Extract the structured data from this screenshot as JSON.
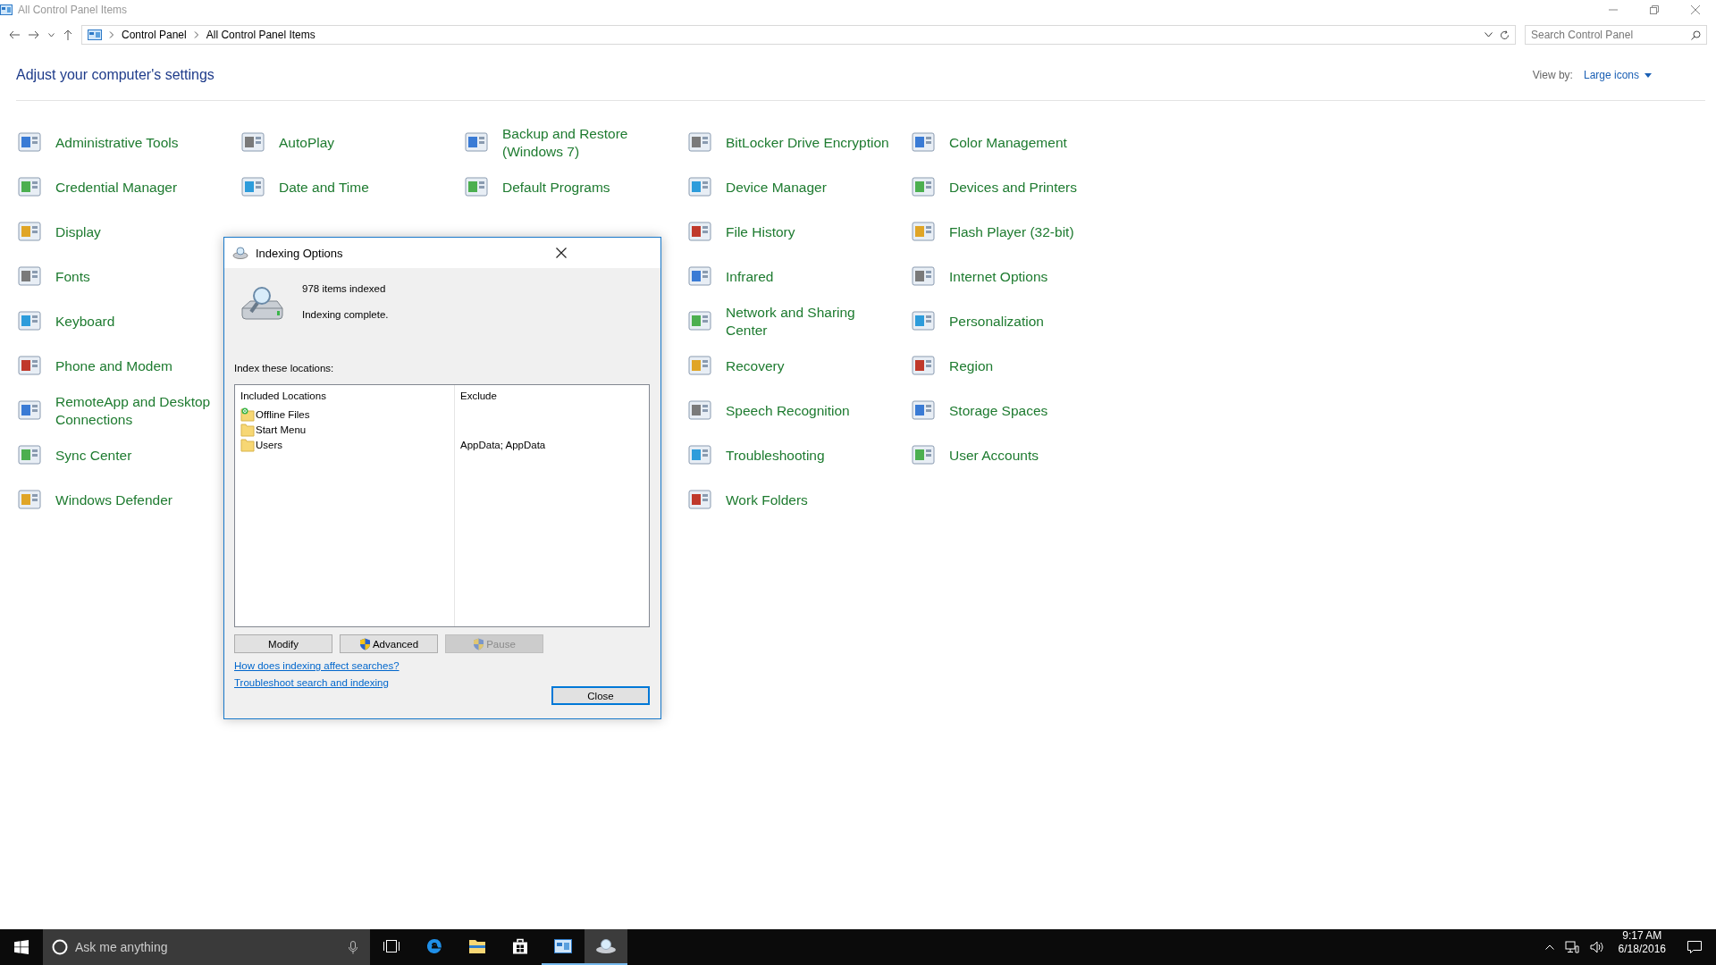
{
  "window": {
    "title": "All Control Panel Items"
  },
  "address_bar": {
    "breadcrumbs": [
      "Control Panel",
      "All Control Panel Items"
    ]
  },
  "search": {
    "placeholder": "Search Control Panel"
  },
  "heading": "Adjust your computer's settings",
  "view_by": {
    "label": "View by:",
    "value": "Large icons"
  },
  "columns": [
    [
      {
        "label": "Administrative Tools"
      },
      {
        "label": "Credential Manager"
      },
      {
        "label": "Display"
      },
      {
        "label": "Fonts"
      },
      {
        "label": "Keyboard"
      },
      {
        "label": "Phone and Modem"
      },
      {
        "label": "RemoteApp and Desktop Connections"
      },
      {
        "label": "Sync Center"
      },
      {
        "label": "Windows Defender"
      }
    ],
    [
      {
        "label": "AutoPlay"
      },
      {
        "label": "Date and Time"
      }
    ],
    [
      {
        "label": "Backup and Restore (Windows 7)"
      },
      {
        "label": "Default Programs"
      }
    ],
    [
      {
        "label": "BitLocker Drive Encryption"
      },
      {
        "label": "Device Manager"
      },
      {
        "label": "File History"
      },
      {
        "label": "Infrared"
      },
      {
        "label": "Network and Sharing Center"
      },
      {
        "label": "Recovery"
      },
      {
        "label": "Speech Recognition"
      },
      {
        "label": "Troubleshooting"
      },
      {
        "label": "Work Folders"
      }
    ],
    [
      {
        "label": "Color Management"
      },
      {
        "label": "Devices and Printers"
      },
      {
        "label": "Flash Player (32-bit)"
      },
      {
        "label": "Internet Options"
      },
      {
        "label": "Personalization"
      },
      {
        "label": "Region"
      },
      {
        "label": "Storage Spaces"
      },
      {
        "label": "User Accounts"
      }
    ]
  ],
  "dialog": {
    "title": "Indexing Options",
    "count": "978 items indexed",
    "status": "Indexing complete.",
    "locations_label": "Index these locations:",
    "table": {
      "columns": [
        "Included Locations",
        "Exclude"
      ],
      "rows": [
        {
          "location": "Offline Files",
          "synced": true
        },
        {
          "location": "Start Menu",
          "synced": false
        },
        {
          "location": "Users",
          "synced": false,
          "exclude": "AppData; AppData"
        }
      ]
    },
    "buttons": [
      {
        "label": "Modify",
        "shield": false,
        "disabled": false
      },
      {
        "label": "Advanced",
        "shield": true,
        "disabled": false
      },
      {
        "label": "Pause",
        "shield": true,
        "disabled": true
      }
    ],
    "links": [
      "How does indexing affect searches?",
      "Troubleshoot search and indexing"
    ],
    "close_button": "Close"
  },
  "taskbar": {
    "search_placeholder": "Ask me anything",
    "apps": [
      {
        "kind": "task-view",
        "open": false,
        "focused": false
      },
      {
        "kind": "browser",
        "open": false,
        "focused": false
      },
      {
        "kind": "folder",
        "open": false,
        "focused": false
      },
      {
        "kind": "store",
        "open": false,
        "focused": false
      },
      {
        "kind": "control-panel",
        "open": true,
        "focused": false
      },
      {
        "kind": "indexing",
        "open": true,
        "focused": true
      }
    ],
    "clock": {
      "time": "9:17 AM",
      "date": "6/18/2016"
    }
  }
}
